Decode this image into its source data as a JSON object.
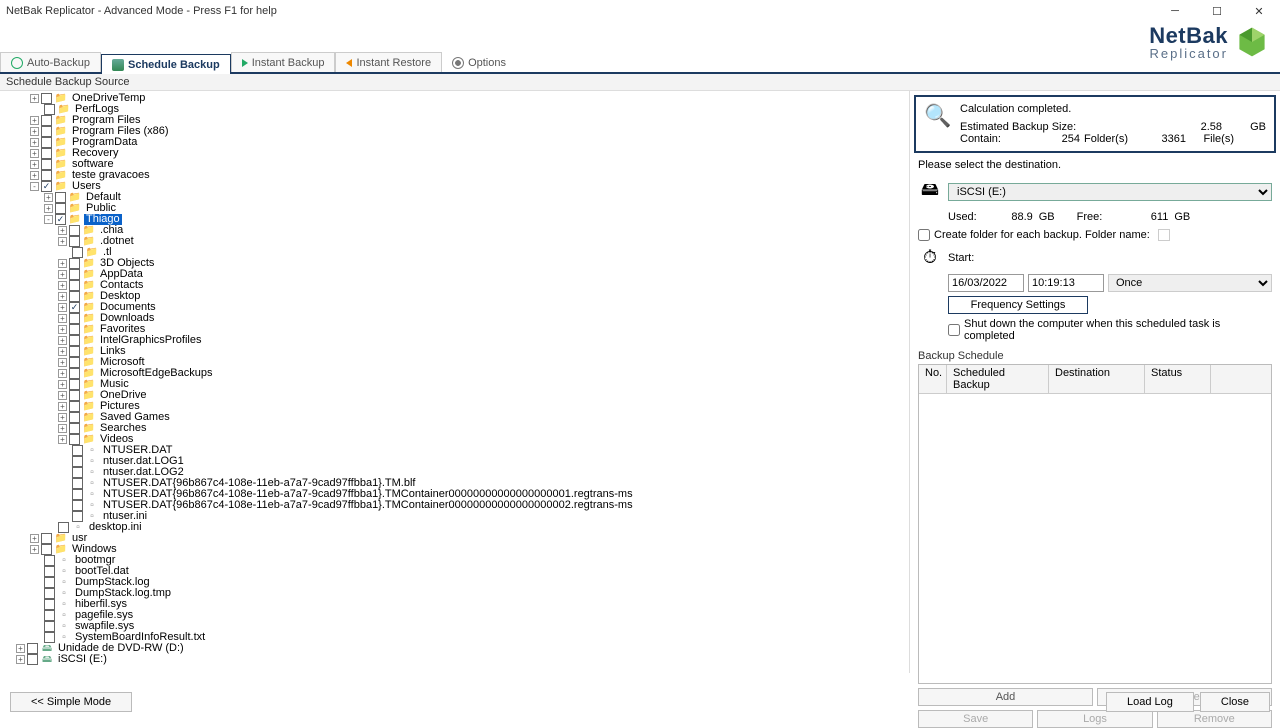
{
  "title": "NetBak Replicator - Advanced Mode - Press F1 for help",
  "brand": {
    "name": "NetBak",
    "sub": "Replicator"
  },
  "tabs": {
    "auto": "Auto-Backup",
    "schedule": "Schedule Backup",
    "instant": "Instant Backup",
    "restore": "Instant Restore",
    "options": "Options"
  },
  "subheader": "Schedule Backup Source",
  "tree": [
    {
      "d": 2,
      "e": "+",
      "c": 0,
      "i": "folder",
      "t": "OneDriveTemp"
    },
    {
      "d": 2,
      "e": "",
      "c": 0,
      "i": "folder",
      "t": "PerfLogs"
    },
    {
      "d": 2,
      "e": "+",
      "c": 0,
      "i": "folder",
      "t": "Program Files"
    },
    {
      "d": 2,
      "e": "+",
      "c": 0,
      "i": "folder",
      "t": "Program Files (x86)"
    },
    {
      "d": 2,
      "e": "+",
      "c": 0,
      "i": "folder",
      "t": "ProgramData"
    },
    {
      "d": 2,
      "e": "+",
      "c": 0,
      "i": "folder",
      "t": "Recovery"
    },
    {
      "d": 2,
      "e": "+",
      "c": 0,
      "i": "folder",
      "t": "software"
    },
    {
      "d": 2,
      "e": "+",
      "c": 0,
      "i": "folder",
      "t": "teste gravacoes"
    },
    {
      "d": 2,
      "e": "-",
      "c": 1,
      "i": "folder",
      "t": "Users"
    },
    {
      "d": 3,
      "e": "+",
      "c": 0,
      "i": "folder",
      "t": "Default"
    },
    {
      "d": 3,
      "e": "+",
      "c": 0,
      "i": "folder",
      "t": "Public"
    },
    {
      "d": 3,
      "e": "-",
      "c": 1,
      "i": "folder",
      "t": "Thiago",
      "sel": true
    },
    {
      "d": 4,
      "e": "+",
      "c": 0,
      "i": "folder",
      "t": ".chia"
    },
    {
      "d": 4,
      "e": "+",
      "c": 0,
      "i": "folder",
      "t": ".dotnet"
    },
    {
      "d": 4,
      "e": "",
      "c": 0,
      "i": "folder",
      "t": ".tl"
    },
    {
      "d": 4,
      "e": "+",
      "c": 0,
      "i": "folder",
      "t": "3D Objects"
    },
    {
      "d": 4,
      "e": "+",
      "c": 0,
      "i": "folder",
      "t": "AppData"
    },
    {
      "d": 4,
      "e": "+",
      "c": 0,
      "i": "folder",
      "t": "Contacts"
    },
    {
      "d": 4,
      "e": "+",
      "c": 0,
      "i": "folder",
      "t": "Desktop"
    },
    {
      "d": 4,
      "e": "+",
      "c": 1,
      "i": "folder",
      "t": "Documents"
    },
    {
      "d": 4,
      "e": "+",
      "c": 0,
      "i": "folder",
      "t": "Downloads"
    },
    {
      "d": 4,
      "e": "+",
      "c": 0,
      "i": "folder",
      "t": "Favorites"
    },
    {
      "d": 4,
      "e": "+",
      "c": 0,
      "i": "folder",
      "t": "IntelGraphicsProfiles"
    },
    {
      "d": 4,
      "e": "+",
      "c": 0,
      "i": "folder",
      "t": "Links"
    },
    {
      "d": 4,
      "e": "+",
      "c": 0,
      "i": "folder",
      "t": "Microsoft"
    },
    {
      "d": 4,
      "e": "+",
      "c": 0,
      "i": "folder",
      "t": "MicrosoftEdgeBackups"
    },
    {
      "d": 4,
      "e": "+",
      "c": 0,
      "i": "folder",
      "t": "Music"
    },
    {
      "d": 4,
      "e": "+",
      "c": 0,
      "i": "folder",
      "t": "OneDrive"
    },
    {
      "d": 4,
      "e": "+",
      "c": 0,
      "i": "folder",
      "t": "Pictures"
    },
    {
      "d": 4,
      "e": "+",
      "c": 0,
      "i": "folder",
      "t": "Saved Games"
    },
    {
      "d": 4,
      "e": "+",
      "c": 0,
      "i": "folder",
      "t": "Searches"
    },
    {
      "d": 4,
      "e": "+",
      "c": 0,
      "i": "folder",
      "t": "Videos"
    },
    {
      "d": 4,
      "e": "",
      "c": 0,
      "i": "file",
      "t": "NTUSER.DAT"
    },
    {
      "d": 4,
      "e": "",
      "c": 0,
      "i": "file",
      "t": "ntuser.dat.LOG1"
    },
    {
      "d": 4,
      "e": "",
      "c": 0,
      "i": "file",
      "t": "ntuser.dat.LOG2"
    },
    {
      "d": 4,
      "e": "",
      "c": 0,
      "i": "file",
      "t": "NTUSER.DAT{96b867c4-108e-11eb-a7a7-9cad97ffbba1}.TM.blf"
    },
    {
      "d": 4,
      "e": "",
      "c": 0,
      "i": "file",
      "t": "NTUSER.DAT{96b867c4-108e-11eb-a7a7-9cad97ffbba1}.TMContainer00000000000000000001.regtrans-ms"
    },
    {
      "d": 4,
      "e": "",
      "c": 0,
      "i": "file",
      "t": "NTUSER.DAT{96b867c4-108e-11eb-a7a7-9cad97ffbba1}.TMContainer00000000000000000002.regtrans-ms"
    },
    {
      "d": 4,
      "e": "",
      "c": 0,
      "i": "file",
      "t": "ntuser.ini"
    },
    {
      "d": 3,
      "e": "",
      "c": 0,
      "i": "file",
      "t": "desktop.ini"
    },
    {
      "d": 2,
      "e": "+",
      "c": 0,
      "i": "folder",
      "t": "usr"
    },
    {
      "d": 2,
      "e": "+",
      "c": 0,
      "i": "folder",
      "t": "Windows"
    },
    {
      "d": 2,
      "e": "",
      "c": 0,
      "i": "file",
      "t": "bootmgr"
    },
    {
      "d": 2,
      "e": "",
      "c": 0,
      "i": "file",
      "t": "bootTel.dat"
    },
    {
      "d": 2,
      "e": "",
      "c": 0,
      "i": "file",
      "t": "DumpStack.log"
    },
    {
      "d": 2,
      "e": "",
      "c": 0,
      "i": "file",
      "t": "DumpStack.log.tmp"
    },
    {
      "d": 2,
      "e": "",
      "c": 0,
      "i": "file",
      "t": "hiberfil.sys"
    },
    {
      "d": 2,
      "e": "",
      "c": 0,
      "i": "file",
      "t": "pagefile.sys"
    },
    {
      "d": 2,
      "e": "",
      "c": 0,
      "i": "file",
      "t": "swapfile.sys"
    },
    {
      "d": 2,
      "e": "",
      "c": 0,
      "i": "file",
      "t": "SystemBoardInfoResult.txt"
    },
    {
      "d": 1,
      "e": "+",
      "c": 0,
      "i": "drive",
      "t": "Unidade de DVD-RW (D:)"
    },
    {
      "d": 1,
      "e": "+",
      "c": 0,
      "i": "drive",
      "t": "iSCSI (E:)"
    }
  ],
  "calc": {
    "status": "Calculation completed.",
    "est_label": "Estimated Backup Size:",
    "est_val": "2.58",
    "est_unit": "GB",
    "contain_label": "Contain:",
    "folders_val": "254",
    "folders_unit": "Folder(s)",
    "files_val": "3361",
    "files_unit": "File(s)"
  },
  "dest": {
    "prompt": "Please select the destination.",
    "selected": "iSCSI (E:)",
    "used_label": "Used:",
    "used_val": "88.9",
    "used_unit": "GB",
    "free_label": "Free:",
    "free_val": "611",
    "free_unit": "GB",
    "create_folder_label": "Create folder for each backup. Folder name:"
  },
  "start": {
    "label": "Start:",
    "date": "16/03/2022",
    "time": "10:19:13",
    "once": "Once",
    "freq_btn": "Frequency Settings",
    "shutdown_label": "Shut down the computer when this scheduled task is completed"
  },
  "schedule": {
    "header": "Backup Schedule",
    "cols": {
      "no": "No.",
      "sch": "Scheduled Backup",
      "dest": "Destination",
      "stat": "Status"
    }
  },
  "buttons": {
    "add": "Add",
    "start_schedule": "Start Schedule",
    "save": "Save",
    "logs": "Logs",
    "remove": "Remove",
    "simple": "<< Simple Mode",
    "load_log": "Load Log",
    "close": "Close"
  }
}
